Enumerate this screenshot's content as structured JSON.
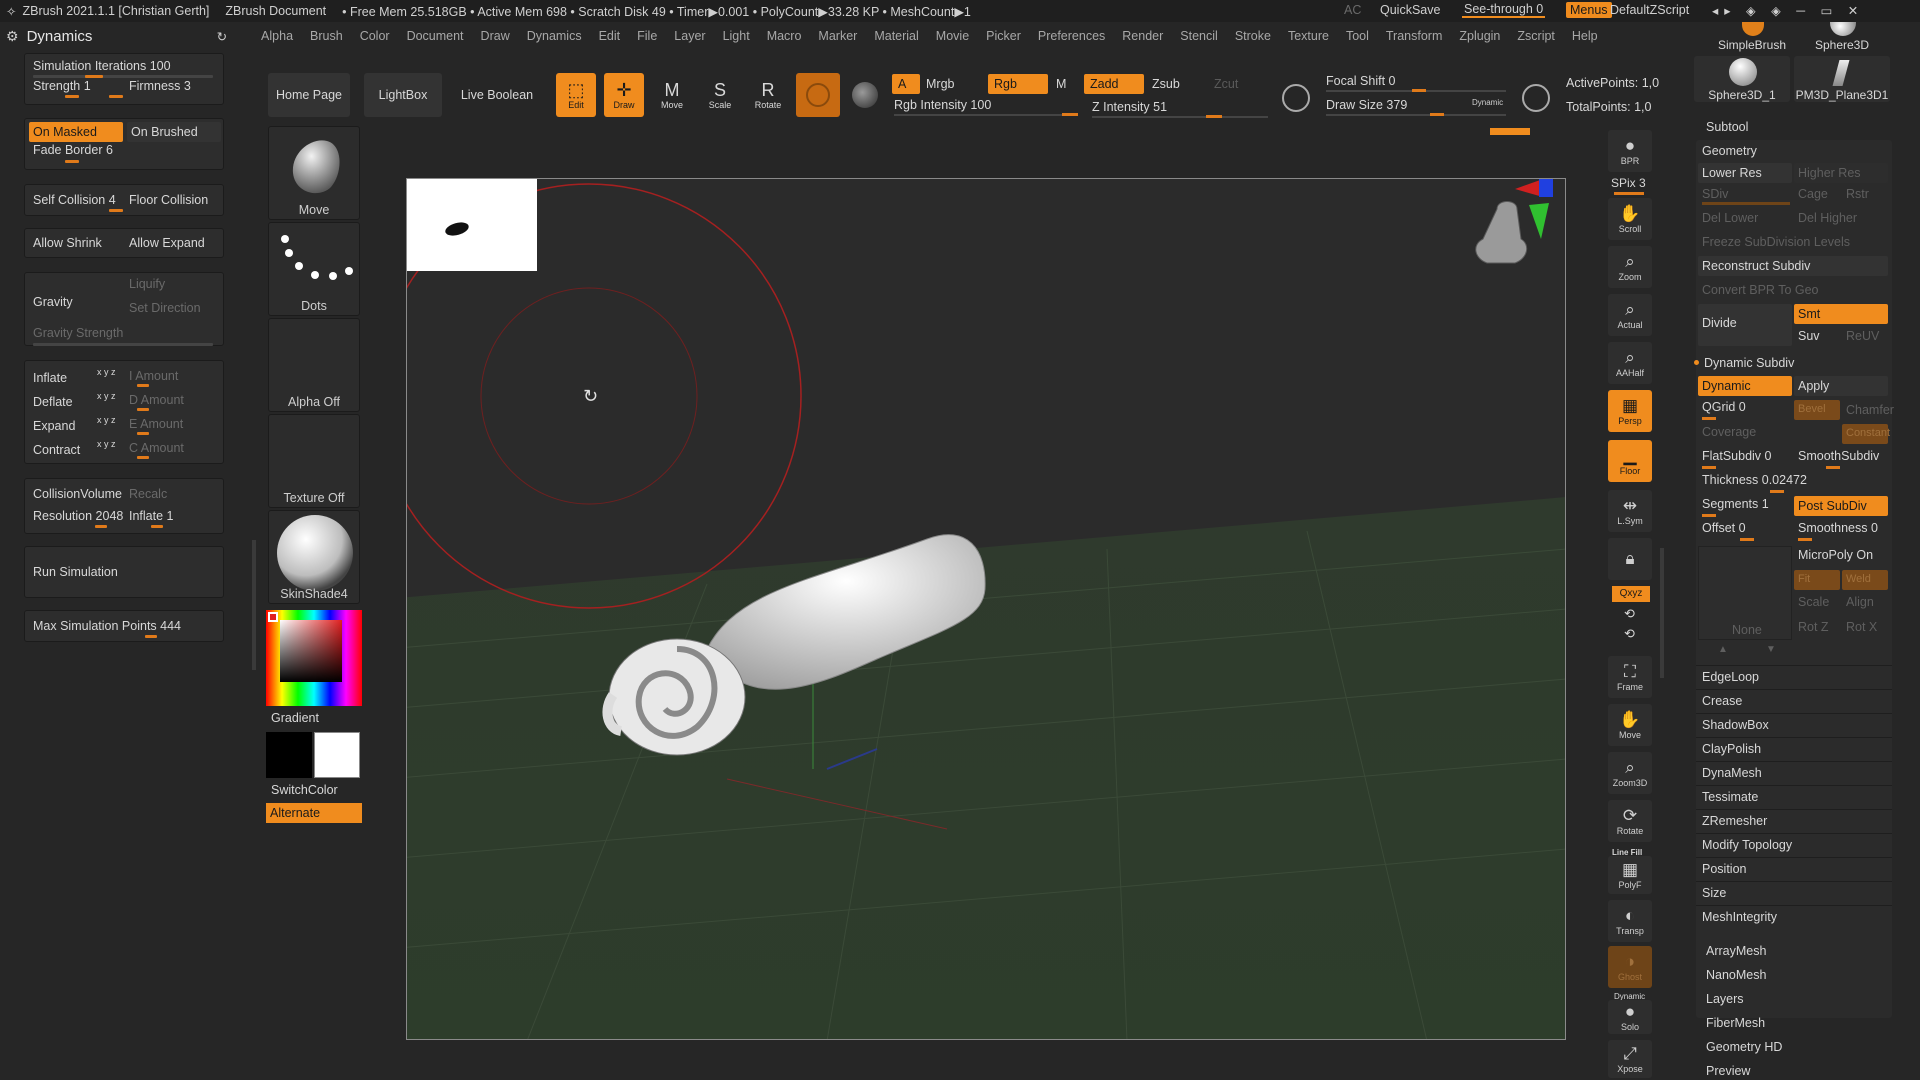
{
  "titlebar": {
    "app": "ZBrush 2021.1.1 [Christian Gerth]",
    "doc": "ZBrush Document",
    "stats": "• Free Mem 25.518GB • Active Mem 698 • Scratch Disk 49 • Timer▶0.001 • PolyCount▶33.28 KP • MeshCount▶1",
    "ac": "AC",
    "quicksave": "QuickSave",
    "seethrough": "See-through  0",
    "menus": "Menus",
    "script": "DefaultZScript"
  },
  "menubar": {
    "panel_title": "Dynamics",
    "items": [
      "Alpha",
      "Brush",
      "Color",
      "Document",
      "Draw",
      "Dynamics",
      "Edit",
      "File",
      "Layer",
      "Light",
      "Macro",
      "Marker",
      "Material",
      "Movie",
      "Picker",
      "Preferences",
      "Render",
      "Stencil",
      "Stroke",
      "Texture",
      "Tool",
      "Transform",
      "Zplugin",
      "Zscript",
      "Help"
    ]
  },
  "dynamics": {
    "sim_iterations": "Simulation Iterations 100",
    "strength": "Strength 1",
    "firmness": "Firmness 3",
    "on_masked": "On Masked",
    "on_brushed": "On Brushed",
    "fade_border": "Fade Border 6",
    "self_collision": "Self Collision 4",
    "floor_collision": "Floor Collision",
    "allow_shrink": "Allow Shrink",
    "allow_expand": "Allow Expand",
    "gravity": "Gravity",
    "liquify": "Liquify",
    "set_direction": "Set Direction",
    "gravity_strength": "Gravity Strength",
    "inflate": "Inflate",
    "deflate": "Deflate",
    "expand": "Expand",
    "contract": "Contract",
    "xyz": "x y z",
    "i_amount": "I Amount",
    "d_amount": "D Amount",
    "e_amount": "E Amount",
    "c_amount": "C Amount",
    "collision_volume": "CollisionVolume",
    "recalc": "Recalc",
    "resolution": "Resolution 2048",
    "inflate1": "Inflate 1",
    "run_simulation": "Run Simulation",
    "max_sim_points": "Max Simulation Points 444"
  },
  "swatches": {
    "move": "Move",
    "dots": "Dots",
    "alpha_off": "Alpha Off",
    "texture_off": "Texture Off",
    "skinshade": "SkinShade4",
    "gradient": "Gradient",
    "switchcolor": "SwitchColor",
    "alternate": "Alternate"
  },
  "toolbar": {
    "home_page": "Home Page",
    "lightbox": "LightBox",
    "live_boolean": "Live Boolean",
    "edit": "Edit",
    "draw": "Draw",
    "move": "Move",
    "scale": "Scale",
    "rotate": "Rotate",
    "a": "A",
    "mrgb": "Mrgb",
    "rgb": "Rgb",
    "m": "M",
    "zadd": "Zadd",
    "zsub": "Zsub",
    "zcut": "Zcut",
    "rgb_intensity": "Rgb Intensity 100",
    "z_intensity": "Z Intensity 51",
    "focal_shift": "Focal Shift 0",
    "draw_size": "Draw Size 379",
    "dynamic": "Dynamic",
    "active_points": "ActivePoints: 1,0",
    "total_points": "TotalPoints: 1,0"
  },
  "shelf": {
    "bpr": "BPR",
    "spix": "SPix 3",
    "scroll": "Scroll",
    "zoom": "Zoom",
    "actual": "Actual",
    "aahalf": "AAHalf",
    "persp": "Persp",
    "floor": "Floor",
    "lsym": "L.Sym",
    "xyz": "Qxyz",
    "frame": "Frame",
    "move": "Move",
    "zoom3d": "Zoom3D",
    "rotate": "Rotate",
    "polyf": "PolyF",
    "linefill": "Line Fill",
    "transp": "Transp",
    "ghost": "Ghost",
    "solo": "Solo",
    "dynamic_label": "Dynamic",
    "xpose": "Xpose"
  },
  "tools": {
    "simplebrush": "SimpleBrush",
    "sphere3d": "Sphere3D",
    "sphere3d_1": "Sphere3D_1",
    "pm3d": "PM3D_Plane3D1"
  },
  "subtool": {
    "subtool": "Subtool",
    "geometry": "Geometry",
    "lower_res": "Lower Res",
    "higher_res": "Higher Res",
    "sdiv": "SDiv",
    "cage": "Cage",
    "rstr": "Rstr",
    "del_lower": "Del Lower",
    "del_higher": "Del Higher",
    "freeze": "Freeze SubDivision Levels",
    "reconstruct": "Reconstruct Subdiv",
    "convert_bpr": "Convert BPR To Geo",
    "divide": "Divide",
    "smt": "Smt",
    "suv": "Suv",
    "reuv": "ReUV",
    "dynamic_subdiv": "Dynamic Subdiv",
    "dynamic": "Dynamic",
    "apply": "Apply",
    "qgrid": "QGrid 0",
    "bevel": "Bevel",
    "chamfer": "Chamfer",
    "coverage": "Coverage",
    "constant": "Constant",
    "flatsubdiv": "FlatSubdiv 0",
    "smoothsubdiv": "SmoothSubdiv",
    "thickness": "Thickness 0.02472",
    "segments": "Segments 1",
    "post_subdiv": "Post SubDiv",
    "offset": "Offset 0",
    "smoothness": "Smoothness 0",
    "micropoly": "MicroPoly On",
    "fit": "Fit",
    "weld": "Weld",
    "scale": "Scale",
    "align": "Align",
    "none": "None",
    "rotz": "Rot Z",
    "rotx": "Rot X",
    "sections": [
      "EdgeLoop",
      "Crease",
      "ShadowBox",
      "ClayPolish",
      "DynaMesh",
      "Tessimate",
      "ZRemesher",
      "Modify Topology",
      "Position",
      "Size",
      "MeshIntegrity"
    ],
    "extra": [
      "ArrayMesh",
      "NanoMesh",
      "Layers",
      "FiberMesh",
      "Geometry HD",
      "Preview"
    ]
  },
  "colors": {
    "accent": "#f08c1e",
    "panel": "#262626",
    "canvas_floor": "#2e3d2c"
  }
}
